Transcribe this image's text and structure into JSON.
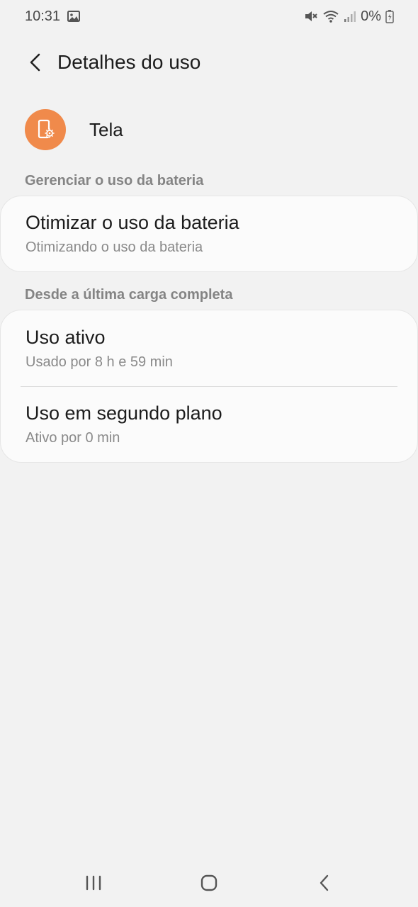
{
  "status_bar": {
    "time": "10:31",
    "battery_percent": "0%",
    "icons": [
      "image-icon",
      "mute-icon",
      "wifi-icon",
      "signal-icon",
      "battery-charging-icon"
    ]
  },
  "app_bar": {
    "title": "Detalhes do uso"
  },
  "app": {
    "name": "Tela",
    "icon": "screen-settings-icon",
    "icon_color": "#f08a4b"
  },
  "sections": {
    "manage_label": "Gerenciar o uso da bateria",
    "optimize": {
      "title": "Otimizar o uso da bateria",
      "subtitle": "Otimizando o uso da bateria"
    },
    "since_label": "Desde a última carga completa",
    "active_use": {
      "title": "Uso ativo",
      "subtitle": "Usado por 8 h e 59 min"
    },
    "background_use": {
      "title": "Uso em segundo plano",
      "subtitle": "Ativo por 0 min"
    }
  },
  "nav_bar": {
    "buttons": [
      "recents-icon",
      "home-icon",
      "back-icon"
    ]
  }
}
